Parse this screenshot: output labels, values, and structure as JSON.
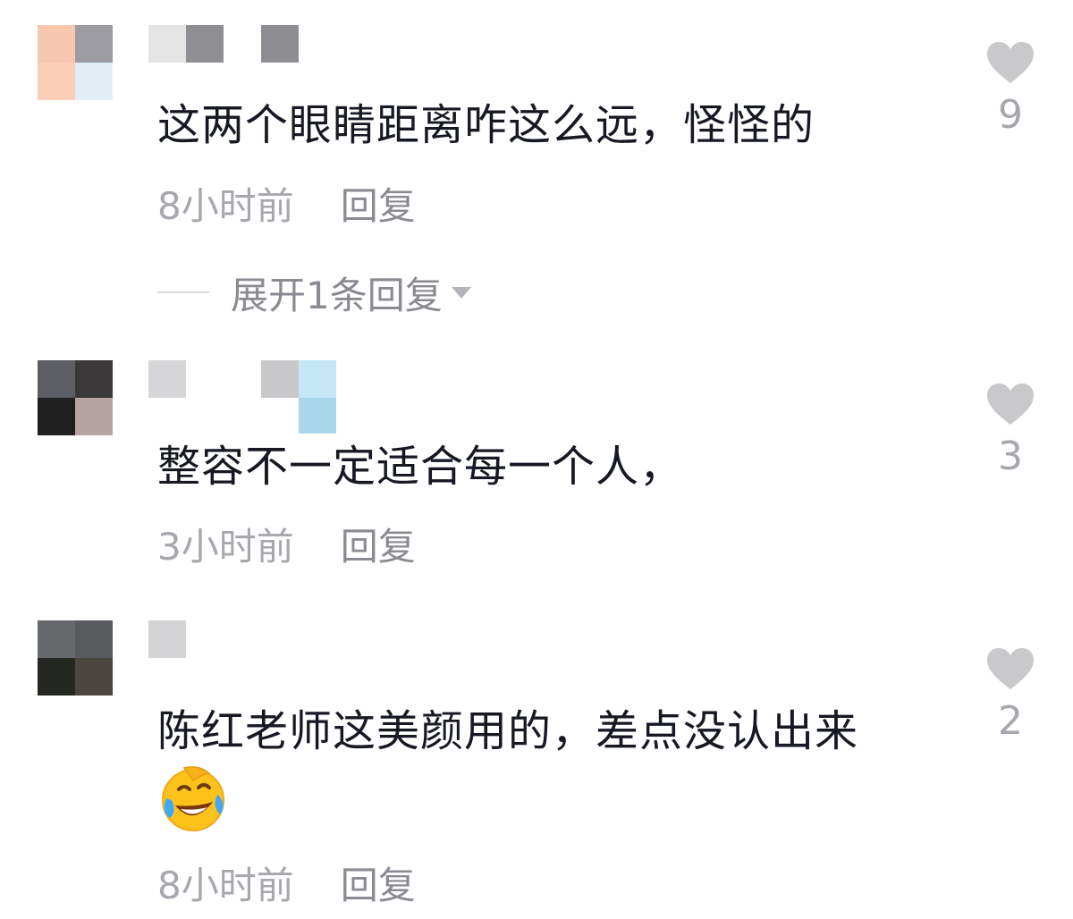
{
  "comments": [
    {
      "text": "这两个眼睛距离咋这么远，怪怪的",
      "time": "8小时前",
      "reply_label": "回复",
      "likes": "9",
      "expand_label": "展开1条回复"
    },
    {
      "text": "整容不一定适合每一个人，",
      "time": "3小时前",
      "reply_label": "回复",
      "likes": "3"
    },
    {
      "text": "陈红老师这美颜用的，差点没认出来",
      "emoji": "laughing-crying-emoji",
      "time": "8小时前",
      "reply_label": "回复",
      "likes": "2"
    }
  ],
  "icons": {
    "like": "heart-icon",
    "expand": "caret-down-icon"
  },
  "colors": {
    "text": "#161823",
    "meta": "#a6a8ad",
    "reply": "#8a8b91",
    "heart": "#c9c9cc"
  }
}
